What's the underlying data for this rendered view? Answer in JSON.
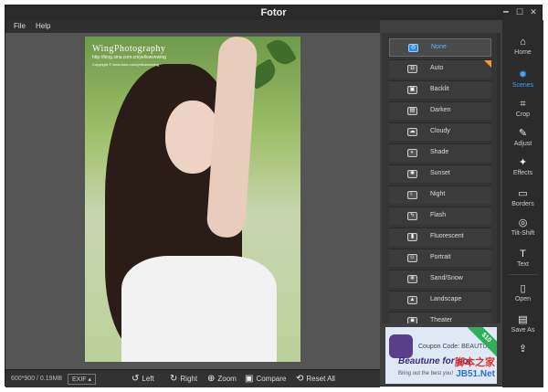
{
  "window": {
    "title": "Fotor",
    "controls": [
      "━",
      "☐",
      "✕"
    ]
  },
  "menu": [
    "File",
    "Help"
  ],
  "photo": {
    "watermark_title": "WingPhotography",
    "watermark_subtitle": "http://blog.sina.com.cn/yellowvewing",
    "watermark_copyright": "Copyright © www.fotor.com/yellowvewing"
  },
  "status": {
    "info": "600*900 / 0.19MB",
    "exif": "EXIF ▴"
  },
  "tools": [
    {
      "icon": "rotate-left-icon",
      "glyph": "↺",
      "label": "Left"
    },
    {
      "icon": "rotate-right-icon",
      "glyph": "↻",
      "label": "Right"
    },
    {
      "icon": "zoom-icon",
      "glyph": "⊕",
      "label": "Zoom"
    },
    {
      "icon": "compare-icon",
      "glyph": "▣",
      "label": "Compare"
    },
    {
      "icon": "reset-icon",
      "glyph": "⟲",
      "label": "Reset All"
    }
  ],
  "scenes": [
    {
      "label": "None",
      "glyph": "◎",
      "selected": true
    },
    {
      "label": "Auto",
      "glyph": "◘",
      "selected": false
    },
    {
      "label": "Backlit",
      "glyph": "▣",
      "selected": false
    },
    {
      "label": "Darken",
      "glyph": "▤",
      "selected": false
    },
    {
      "label": "Cloudy",
      "glyph": "☁",
      "selected": false
    },
    {
      "label": "Shade",
      "glyph": "◐",
      "selected": false
    },
    {
      "label": "Sunset",
      "glyph": "✺",
      "selected": false
    },
    {
      "label": "Night",
      "glyph": "☾",
      "selected": false
    },
    {
      "label": "Flash",
      "glyph": "ϟ",
      "selected": false
    },
    {
      "label": "Fluorescent",
      "glyph": "▮",
      "selected": false
    },
    {
      "label": "Portrait",
      "glyph": "☺",
      "selected": false
    },
    {
      "label": "Sand/Snow",
      "glyph": "❄",
      "selected": false
    },
    {
      "label": "Landscape",
      "glyph": "▲",
      "selected": false
    },
    {
      "label": "Theater",
      "glyph": "◙",
      "selected": false
    }
  ],
  "ad": {
    "coupon": "Coupon Code: BEAUTUNE",
    "brand": "Beautune for por",
    "tagline": "Bring out the best you!",
    "ribbon": "$10",
    "watermark_cn": "脚本之家",
    "watermark_site": "JB51.Net"
  },
  "nav": [
    {
      "name": "home",
      "glyph": "⌂",
      "label": "Home",
      "active": false
    },
    {
      "name": "scenes",
      "glyph": "✹",
      "label": "Scenes",
      "active": true
    },
    {
      "name": "crop",
      "glyph": "⌗",
      "label": "Crop",
      "active": false
    },
    {
      "name": "adjust",
      "glyph": "✎",
      "label": "Adjust",
      "active": false
    },
    {
      "name": "effects",
      "glyph": "✦",
      "label": "Effects",
      "active": false
    },
    {
      "name": "borders",
      "glyph": "▭",
      "label": "Borders",
      "active": false
    },
    {
      "name": "tilt-shift",
      "glyph": "◎",
      "label": "Tilt-Shift",
      "active": false
    },
    {
      "name": "text",
      "glyph": "T",
      "label": "Text",
      "active": false
    },
    {
      "name": "open",
      "glyph": "▯",
      "label": "Open",
      "active": false
    },
    {
      "name": "save-as",
      "glyph": "▤",
      "label": "Save As",
      "active": false
    },
    {
      "name": "share",
      "glyph": "⇪",
      "label": "",
      "active": false
    }
  ]
}
